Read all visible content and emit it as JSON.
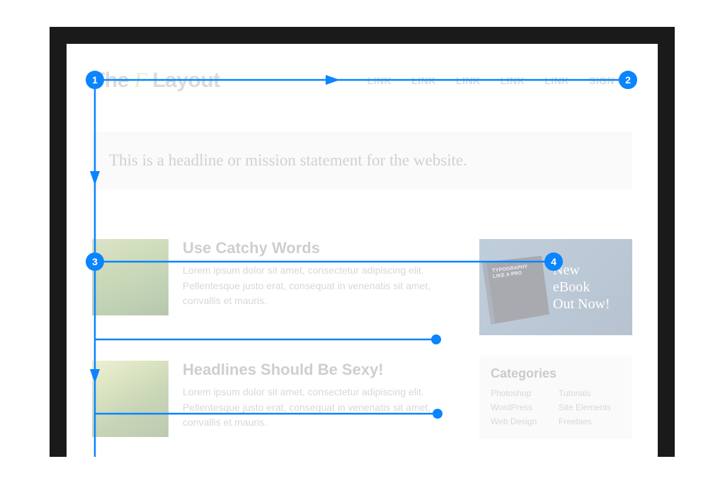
{
  "logo": {
    "prefix": "The ",
    "accent": "F",
    "suffix": " Layout"
  },
  "nav": {
    "links": [
      "LINK",
      "LINK",
      "LINK",
      "LINK",
      "LINK"
    ],
    "cta": "SIGN UP"
  },
  "hero": {
    "headline": "This is a headline or mission statement for the website."
  },
  "posts": [
    {
      "title": "Use Catchy Words",
      "excerpt": "Lorem ipsum dolor sit amet, consectetur adipiscing elit. Pellentesque justo erat, consequat in venenatis sit amet, convallis et mauris."
    },
    {
      "title": "Headlines Should Be Sexy!",
      "excerpt": "Lorem ipsum dolor sit amet, consectetur adipiscing elit. Pellentesque justo erat, consequat in venenatis sit amet, convallis et mauris."
    }
  ],
  "promo": {
    "book_cover": "TYPOGRAPHY LIKE A PRO",
    "line1": "New",
    "line2": "eBook",
    "line3": "Out Now!"
  },
  "categories": {
    "title": "Categories",
    "items": [
      "Photoshop",
      "Tutorials",
      "WordPress",
      "Site Elements",
      "Web Design",
      "Freebies"
    ]
  },
  "diagram": {
    "nodes": {
      "n1": "1",
      "n2": "2",
      "n3": "3",
      "n4": "4"
    }
  }
}
